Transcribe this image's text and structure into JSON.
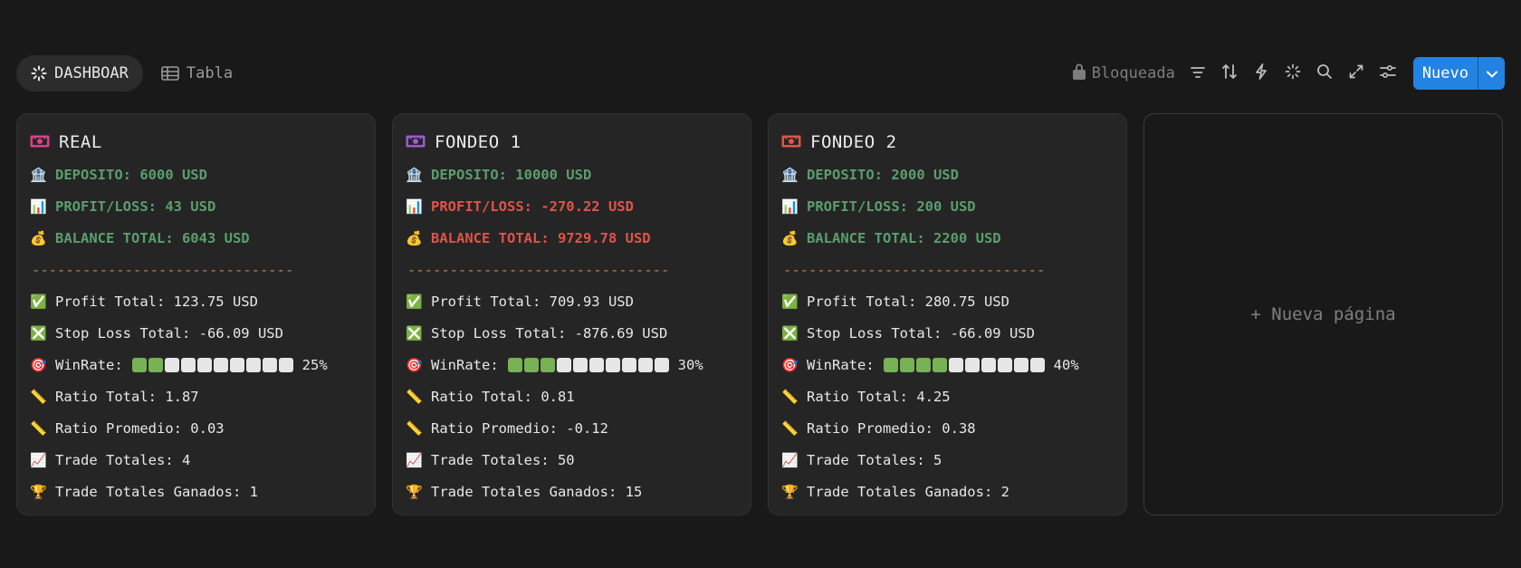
{
  "views": [
    {
      "label": "DASHBOAR",
      "icon": "loading-spinner-icon",
      "active": true
    },
    {
      "label": "Tabla",
      "icon": "table-icon",
      "active": false
    }
  ],
  "toolbar": {
    "lock_label": "Bloqueada",
    "new_label": "Nuevo",
    "tools": [
      "filter-icon",
      "sort-icon",
      "automation-bolt-icon",
      "sparkle-icon",
      "search-icon",
      "expand-icon",
      "settings-sliders-icon"
    ]
  },
  "cards": [
    {
      "title": "REAL",
      "icon_color": "#d9408a",
      "deposito": "🏦",
      "lines": {
        "deposito": "DEPOSITO: 6000 USD",
        "profit_loss": "PROFIT/LOSS: 43 USD",
        "balance": "BALANCE TOTAL: 6043 USD",
        "divider": "-------------------------------",
        "profit_total": "Profit Total: 123.75 USD",
        "stop_loss": "Stop Loss Total: -66.09 USD",
        "winrate_label": "WinRate:",
        "winrate_pct": "25%",
        "ratio_total": "Ratio Total: 1.87",
        "ratio_promedio": "Ratio Promedio: 0.03",
        "trades": "Trade Totales: 4",
        "won": "Trade Totales Ganados: 1"
      },
      "winrate_filled": 2,
      "winrate_total": 10,
      "pl_status": "positive"
    },
    {
      "title": "FONDEO 1",
      "icon_color": "#9b59d0",
      "lines": {
        "deposito": "DEPOSITO: 10000 USD",
        "profit_loss": "PROFIT/LOSS: -270.22 USD",
        "balance": "BALANCE TOTAL: 9729.78 USD",
        "divider": "-------------------------------",
        "profit_total": "Profit Total: 709.93 USD",
        "stop_loss": "Stop Loss Total: -876.69 USD",
        "winrate_label": "WinRate:",
        "winrate_pct": "30%",
        "ratio_total": "Ratio Total: 0.81",
        "ratio_promedio": "Ratio Promedio: -0.12",
        "trades": "Trade Totales: 50",
        "won": "Trade Totales Ganados: 15"
      },
      "winrate_filled": 3,
      "winrate_total": 10,
      "pl_status": "negative"
    },
    {
      "title": "FONDEO 2",
      "icon_color": "#e0534b",
      "lines": {
        "deposito": "DEPOSITO: 2000 USD",
        "profit_loss": "PROFIT/LOSS: 200 USD",
        "balance": "BALANCE TOTAL: 2200 USD",
        "divider": "-------------------------------",
        "profit_total": "Profit Total: 280.75 USD",
        "stop_loss": "Stop Loss Total: -66.09 USD",
        "winrate_label": "WinRate:",
        "winrate_pct": "40%",
        "ratio_total": "Ratio Total: 4.25",
        "ratio_promedio": "Ratio Promedio: 0.38",
        "trades": "Trade Totales: 5",
        "won": "Trade Totales Ganados: 2"
      },
      "winrate_filled": 4,
      "winrate_total": 10,
      "pl_status": "positive"
    }
  ],
  "emojis": {
    "deposito": "🏦",
    "profit_loss": "📊",
    "balance": "💰",
    "profit_total": "✅",
    "stop_loss": "❎",
    "winrate": "🎯",
    "ratio_total": "📏",
    "ratio_promedio": "📏",
    "trades": "📈",
    "won": "🏆"
  },
  "new_page": {
    "label": "+ Nueva página"
  },
  "colors": {
    "positive": "#5b9e6e",
    "negative": "#e0534b",
    "accent": "#2383e2"
  }
}
